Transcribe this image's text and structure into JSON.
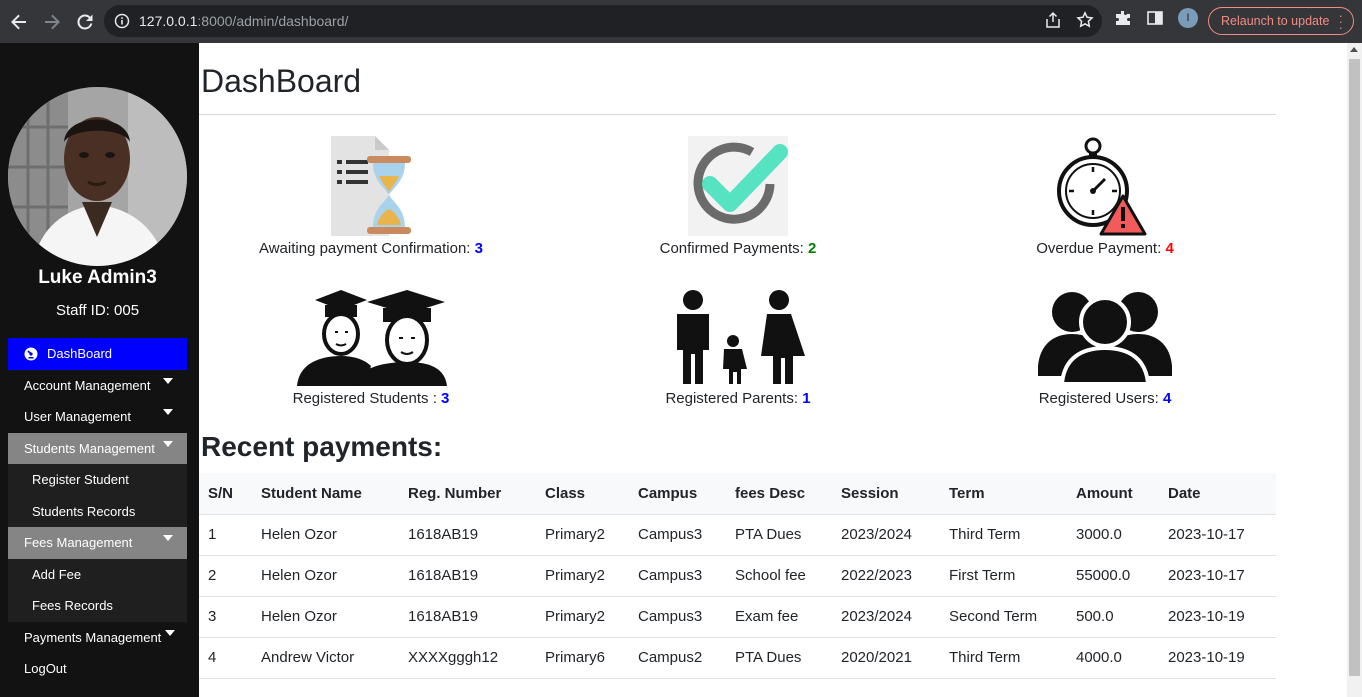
{
  "browser": {
    "url_host": "127.0.0.1",
    "url_path": ":8000/admin/dashboard/",
    "relaunch_label": "Relaunch to update",
    "profile_initial": "I"
  },
  "sidebar": {
    "user_name": "Luke Admin3",
    "staff_id": "Staff ID: 005",
    "items": [
      {
        "label": "DashBoard",
        "state": "active"
      },
      {
        "label": "Account Management",
        "state": "collapsed"
      },
      {
        "label": "User Management",
        "state": "collapsed"
      },
      {
        "label": "Students Management",
        "state": "open"
      },
      {
        "label": "Register Student",
        "state": "sub"
      },
      {
        "label": "Students Records",
        "state": "sub"
      },
      {
        "label": "Fees Management",
        "state": "open"
      },
      {
        "label": "Add Fee",
        "state": "sub"
      },
      {
        "label": "Fees Records",
        "state": "sub"
      },
      {
        "label": "Payments Management",
        "state": "collapsed"
      },
      {
        "label": "LogOut",
        "state": "plain"
      }
    ]
  },
  "main": {
    "title": "DashBoard",
    "cards": [
      {
        "label": "Awaiting payment Confirmation: ",
        "count": "3",
        "color": "#0000ff",
        "icon": "hourglass-document-icon"
      },
      {
        "label": "Confirmed Payments: ",
        "count": "2",
        "color": "#008000",
        "icon": "checkmark-icon"
      },
      {
        "label": "Overdue Payment: ",
        "count": "4",
        "color": "#ff0000",
        "icon": "stopwatch-warning-icon"
      },
      {
        "label": "Registered Students : ",
        "count": "3",
        "color": "#0000ff",
        "icon": "graduates-icon"
      },
      {
        "label": "Registered Parents: ",
        "count": "1",
        "color": "#0000ff",
        "icon": "family-icon"
      },
      {
        "label": "Registered Users: ",
        "count": "4",
        "color": "#0000ff",
        "icon": "users-group-icon"
      }
    ],
    "recent_title": "Recent payments:",
    "table": {
      "headers": [
        "S/N",
        "Student Name",
        "Reg. Number",
        "Class",
        "Campus",
        "fees Desc",
        "Session",
        "Term",
        "Amount",
        "Date"
      ],
      "rows": [
        [
          "1",
          "Helen Ozor",
          "1618AB19",
          "Primary2",
          "Campus3",
          "PTA Dues",
          "2023/2024",
          "Third Term",
          "3000.0",
          "2023-10-17"
        ],
        [
          "2",
          "Helen Ozor",
          "1618AB19",
          "Primary2",
          "Campus3",
          "School fee",
          "2022/2023",
          "First Term",
          "55000.0",
          "2023-10-17"
        ],
        [
          "3",
          "Helen Ozor",
          "1618AB19",
          "Primary2",
          "Campus3",
          "Exam fee",
          "2023/2024",
          "Second Term",
          "500.0",
          "2023-10-19"
        ],
        [
          "4",
          "Andrew Victor",
          "XXXXgggh12",
          "Primary6",
          "Campus2",
          "PTA Dues",
          "2020/2021",
          "Third Term",
          "4000.0",
          "2023-10-19"
        ]
      ]
    }
  }
}
